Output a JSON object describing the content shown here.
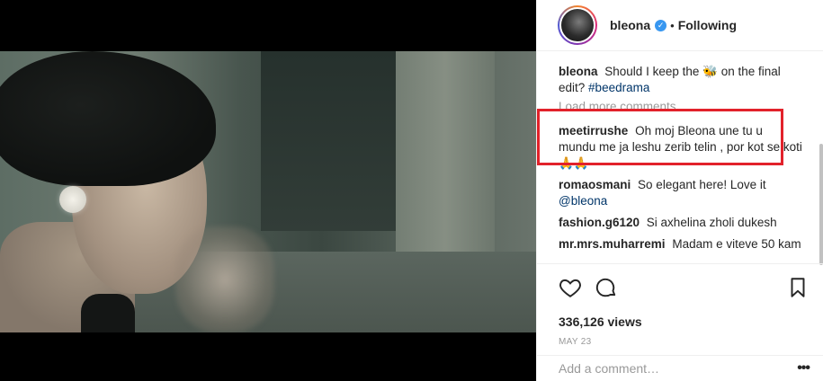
{
  "post": {
    "username": "bleona",
    "verified_icon": "verified-badge-icon",
    "separator": "•",
    "follow_status": "Following"
  },
  "caption": {
    "username": "bleona",
    "text_before": "Should I keep the",
    "emoji": "🐝",
    "text_after": "on the final edit?",
    "hashtag": "#beedrama"
  },
  "load_more": "Load more comments",
  "comments": [
    {
      "username": "meetirrushe",
      "text": "Oh moj Bleona une tu u mundu me ja leshu zerib telin , por kot se koti 🙏🙏",
      "mention": ""
    },
    {
      "username": "romaosmani",
      "text": "So elegant here! Love it",
      "mention": "@bleona"
    },
    {
      "username": "fashion.g6120",
      "text": "Si axhelina zholi dukesh",
      "mention": ""
    },
    {
      "username": "mr.mrs.muharremi",
      "text": "Madam e viteve 50 kam",
      "mention": ""
    }
  ],
  "actions": {
    "like_icon": "heart-icon",
    "comment_icon": "comment-bubble-icon",
    "save_icon": "bookmark-icon"
  },
  "stats": {
    "views": "336,126 views",
    "date": "MAY 23"
  },
  "add_comment": {
    "placeholder": "Add a comment…",
    "more_label": "•••"
  },
  "colors": {
    "highlight": "#e2222b",
    "link": "#003569",
    "verified": "#3897f0"
  }
}
